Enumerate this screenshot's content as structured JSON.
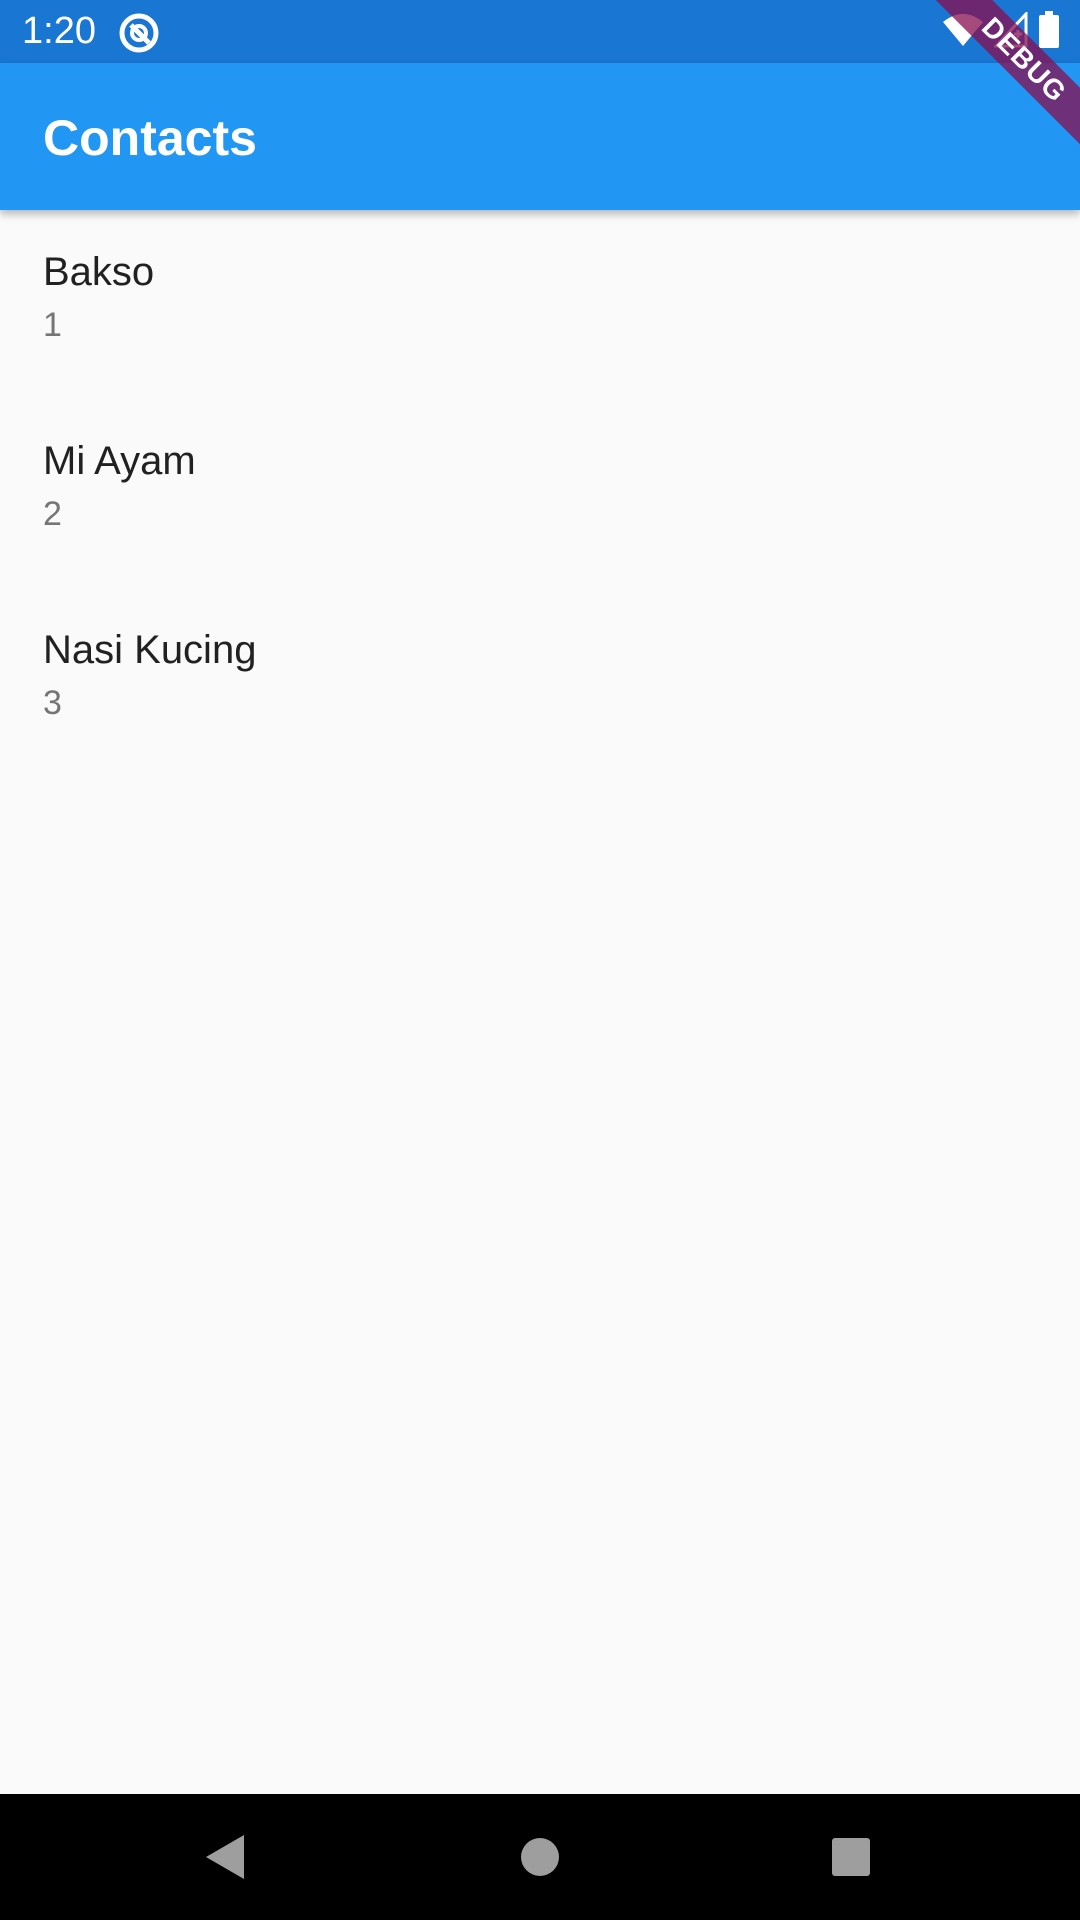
{
  "status_bar": {
    "time": "1:20",
    "icons": [
      "app-notification-icon",
      "wifi-icon",
      "cellular-icon",
      "battery-icon"
    ]
  },
  "app_bar": {
    "title": "Contacts"
  },
  "debug_banner": {
    "label": "DEBUG"
  },
  "contacts": [
    {
      "name": "Bakso",
      "number": "1"
    },
    {
      "name": "Mi Ayam",
      "number": "2"
    },
    {
      "name": "Nasi Kucing",
      "number": "3"
    }
  ],
  "nav_bar": {
    "icons": [
      "back-icon",
      "home-icon",
      "recents-icon"
    ]
  },
  "colors": {
    "status_bar": "#1976d2",
    "app_bar": "#2196f3",
    "background": "#fafafa",
    "title_text": "#212121",
    "subtitle_text": "#757575",
    "debug_banner": "#880e4f"
  }
}
